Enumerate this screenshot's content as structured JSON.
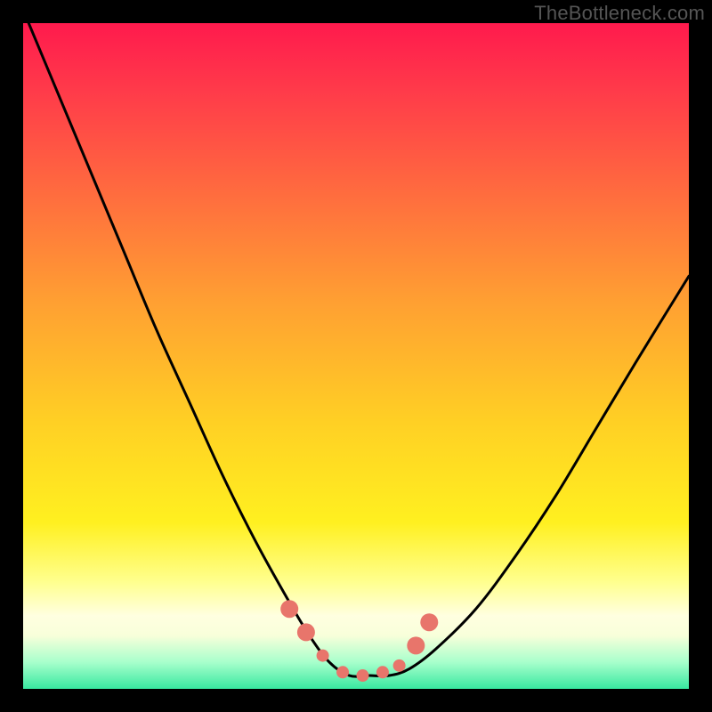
{
  "watermark": "TheBottleneck.com",
  "chart_data": {
    "type": "line",
    "title": "",
    "xlabel": "",
    "ylabel": "",
    "xlim": [
      0,
      100
    ],
    "ylim": [
      0,
      100
    ],
    "series": [
      {
        "name": "bottleneck-curve",
        "x": [
          0,
          5,
          10,
          15,
          20,
          25,
          30,
          35,
          40,
          43,
          46,
          49,
          52,
          55,
          58,
          62,
          68,
          74,
          80,
          86,
          92,
          100
        ],
        "values": [
          102,
          90,
          78,
          66,
          54,
          43,
          32,
          22,
          13,
          8,
          4,
          2,
          2,
          2,
          3,
          6,
          12,
          20,
          29,
          39,
          49,
          62
        ]
      }
    ],
    "markers": {
      "name": "highlight-dots",
      "x": [
        40,
        42.5,
        45,
        48,
        51,
        54,
        56.5,
        59,
        61
      ],
      "values": [
        12,
        8.5,
        5,
        2.5,
        2,
        2.5,
        3.5,
        6.5,
        10
      ],
      "color": "#e8756b",
      "radius_major": 10,
      "radius_minor": 7
    },
    "gradient_stops": [
      {
        "pos": 0.0,
        "color": "#ff1a4d"
      },
      {
        "pos": 0.25,
        "color": "#ff6a3f"
      },
      {
        "pos": 0.6,
        "color": "#ffd024"
      },
      {
        "pos": 0.85,
        "color": "#ffff8f"
      },
      {
        "pos": 1.0,
        "color": "#38e8a0"
      }
    ]
  }
}
